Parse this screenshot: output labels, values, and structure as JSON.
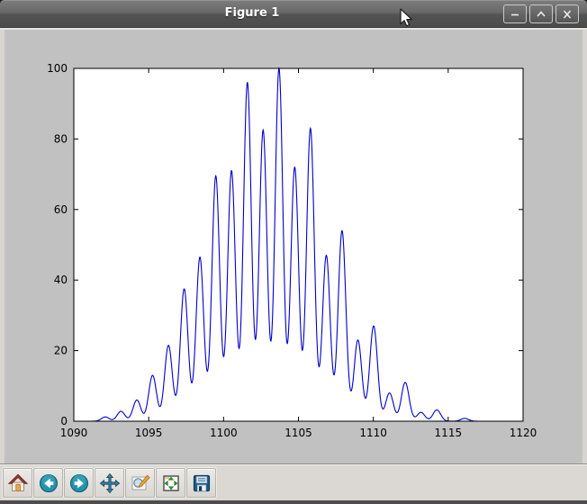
{
  "window": {
    "title": "Figure 1",
    "controls": [
      {
        "name": "minimize"
      },
      {
        "name": "maximize"
      },
      {
        "name": "close"
      }
    ]
  },
  "toolbar": {
    "buttons": [
      {
        "name": "home"
      },
      {
        "name": "back"
      },
      {
        "name": "forward"
      },
      {
        "name": "pan"
      },
      {
        "name": "zoom-to-rect"
      },
      {
        "name": "configure-subplots"
      },
      {
        "name": "save"
      }
    ]
  },
  "colors": {
    "titlebar": "#696969",
    "window_background": "#d8d5d0",
    "figure_background": "#c1c1c1",
    "plot_background": "#ffffff",
    "line": "#0000cc",
    "toolbar_background": "#dbd8d3"
  },
  "chart_data": {
    "type": "line",
    "title": "",
    "xlabel": "",
    "ylabel": "",
    "xlim": [
      1090,
      1120
    ],
    "ylim": [
      0,
      100
    ],
    "xticks": [
      1090,
      1095,
      1100,
      1105,
      1110,
      1115,
      1120
    ],
    "yticks": [
      0,
      20,
      40,
      60,
      80,
      100
    ],
    "legend": null,
    "grid": false,
    "line_color": "#0000cc",
    "description": "Spectrum-like curve: sum of Gaussian peaks (sigma below) spaced ~1.05 apart under a bell envelope",
    "sigma": 0.26,
    "peaks": [
      {
        "x": 1092.1,
        "a": 1.2
      },
      {
        "x": 1093.15,
        "a": 2.8
      },
      {
        "x": 1094.21,
        "a": 6.0
      },
      {
        "x": 1095.26,
        "a": 13.0
      },
      {
        "x": 1096.32,
        "a": 21.5
      },
      {
        "x": 1097.37,
        "a": 37.5
      },
      {
        "x": 1098.42,
        "a": 46.5
      },
      {
        "x": 1099.48,
        "a": 69.5
      },
      {
        "x": 1100.53,
        "a": 71.0
      },
      {
        "x": 1101.59,
        "a": 96.0
      },
      {
        "x": 1102.64,
        "a": 82.5
      },
      {
        "x": 1103.7,
        "a": 100.0
      },
      {
        "x": 1104.75,
        "a": 72.0
      },
      {
        "x": 1105.8,
        "a": 83.0
      },
      {
        "x": 1106.86,
        "a": 47.0
      },
      {
        "x": 1107.91,
        "a": 54.0
      },
      {
        "x": 1108.97,
        "a": 23.0
      },
      {
        "x": 1110.02,
        "a": 27.0
      },
      {
        "x": 1111.08,
        "a": 8.0
      },
      {
        "x": 1112.13,
        "a": 11.0
      },
      {
        "x": 1113.18,
        "a": 2.5
      },
      {
        "x": 1114.24,
        "a": 3.2
      },
      {
        "x": 1116.1,
        "a": 0.8
      }
    ]
  }
}
